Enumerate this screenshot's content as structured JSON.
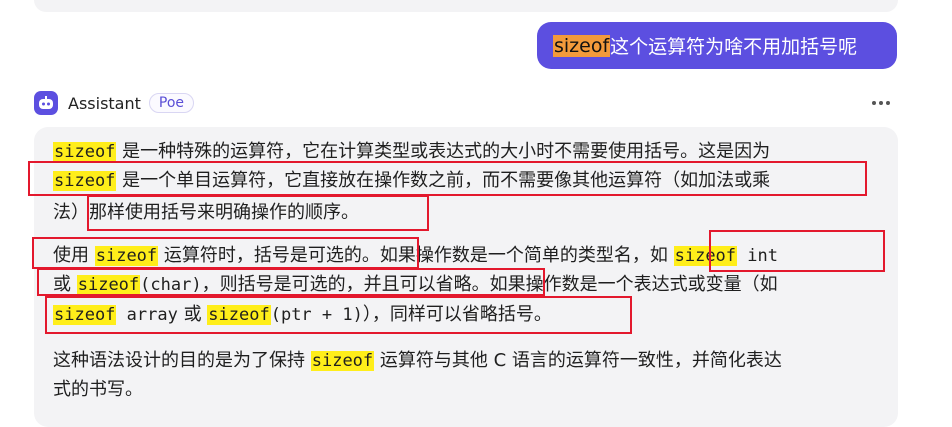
{
  "colors": {
    "accent": "#5c4fe0",
    "keyword_highlight_user": "#f39a3b",
    "keyword_highlight_answer": "#ffee1a",
    "annotation_box": "#e3182d"
  },
  "user_message": {
    "keyword": "sizeof",
    "text": " 这个运算符为啥不用加括号呢"
  },
  "assistant": {
    "avatar_icon": "robot-icon",
    "name": "Assistant",
    "badge": "Poe",
    "more_icon": "more-dots-icon"
  },
  "answer": {
    "p1": {
      "l1_kw": "sizeof",
      "l1_text": " 是一种特殊的运算符，它在计算类型或表达式的大小时不需要使用括号。这是因为",
      "l2_kw": "sizeof",
      "l2_text": " 是一个单目运算符，它直接放在操作数之前，而不需要像其他运算符（如加法或乘",
      "l3_text": "法）那样使用括号来明确操作的顺序。"
    },
    "p2": {
      "l1_a": "使用 ",
      "l1_kw": "sizeof",
      "l1_b": " 运算符时，括号是可选的。如果操作数是一个简单的类型名，如 ",
      "l1_kw2": "sizeof",
      "l1_code": " int",
      "l2_a": "或 ",
      "l2_kw": "sizeof",
      "l2_code": "(char)",
      "l2_b": "，则括号是可选的，并且可以省略。如果操作数是一个表达式或变量（如",
      "l3_kw": "sizeof",
      "l3_code": " array",
      "l3_a": " 或 ",
      "l3_kw2": "sizeof",
      "l3_code2": "(ptr + 1)",
      "l3_b": "），同样可以省略括号。"
    },
    "p3": {
      "l1_a": "这种语法设计的目的是为了保持 ",
      "l1_kw": "sizeof",
      "l1_b": " 运算符与其他 C 语言的运算符一致性，并简化表达",
      "l2_text": "式的书写。"
    }
  }
}
